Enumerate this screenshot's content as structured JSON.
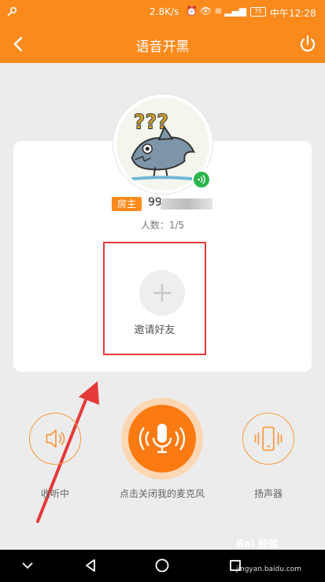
{
  "status_bar": {
    "speed": "2.8K/s",
    "battery": "75",
    "time": "中午12:28"
  },
  "title_bar": {
    "title": "语音开黑"
  },
  "room": {
    "host_badge": "房主",
    "host_name_visible": "99",
    "member_count": "人数：1/5",
    "invite_label": "邀请好友",
    "avatar_text": "???"
  },
  "controls": {
    "listen_label": "收听中",
    "mic_label": "点击关闭我的麦克风",
    "speaker_label": "扬声器"
  },
  "watermark": {
    "brand": "Bai 经验",
    "url": "jingyan.baidu.com"
  },
  "colors": {
    "accent": "#fb8a1c",
    "mic": "#fb7a12",
    "highlight_box": "#e43a3a",
    "voice_badge": "#2bb54a"
  }
}
